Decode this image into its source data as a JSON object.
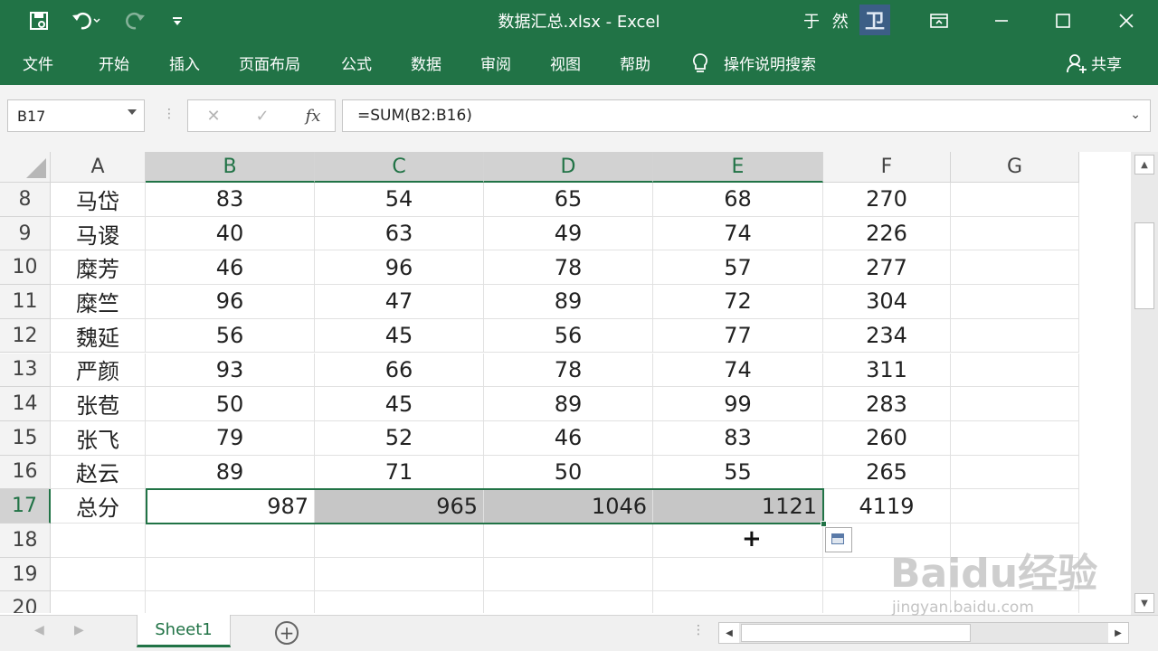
{
  "window": {
    "title": "数据汇总.xlsx  -  Excel",
    "user": "于 然",
    "user_avatar": "卫",
    "icons": {
      "save": "save-icon",
      "undo": "undo-icon",
      "redo": "redo-icon",
      "customize": "customize-qat-icon",
      "ribbon_display": "ribbon-display-icon",
      "minimize": "minimize-icon",
      "maximize": "maximize-icon",
      "close": "close-icon"
    }
  },
  "ribbon": {
    "tabs": [
      "文件",
      "开始",
      "插入",
      "页面布局",
      "公式",
      "数据",
      "审阅",
      "视图",
      "帮助"
    ],
    "tell_me": "操作说明搜索",
    "share": "共享"
  },
  "formula_bar": {
    "name_box": "B17",
    "cancel": "✕",
    "enter": "✓",
    "fx": "fx",
    "formula": "=SUM(B2:B16)"
  },
  "grid": {
    "columns": [
      "A",
      "B",
      "C",
      "D",
      "E",
      "F",
      "G"
    ],
    "rows": [
      {
        "num": "8",
        "cells": [
          "马岱",
          "83",
          "54",
          "65",
          "68",
          "270",
          ""
        ]
      },
      {
        "num": "9",
        "cells": [
          "马谡",
          "40",
          "63",
          "49",
          "74",
          "226",
          ""
        ]
      },
      {
        "num": "10",
        "cells": [
          "糜芳",
          "46",
          "96",
          "78",
          "57",
          "277",
          ""
        ]
      },
      {
        "num": "11",
        "cells": [
          "糜竺",
          "96",
          "47",
          "89",
          "72",
          "304",
          ""
        ]
      },
      {
        "num": "12",
        "cells": [
          "魏延",
          "56",
          "45",
          "56",
          "77",
          "234",
          ""
        ]
      },
      {
        "num": "13",
        "cells": [
          "严颜",
          "93",
          "66",
          "78",
          "74",
          "311",
          ""
        ]
      },
      {
        "num": "14",
        "cells": [
          "张苞",
          "50",
          "45",
          "89",
          "99",
          "283",
          ""
        ]
      },
      {
        "num": "15",
        "cells": [
          "张飞",
          "79",
          "52",
          "46",
          "83",
          "260",
          ""
        ]
      },
      {
        "num": "16",
        "cells": [
          "赵云",
          "89",
          "71",
          "50",
          "55",
          "265",
          ""
        ]
      },
      {
        "num": "17",
        "cells": [
          "总分",
          "987",
          "965",
          "1046",
          "1121",
          "4119",
          ""
        ]
      },
      {
        "num": "18",
        "cells": [
          "",
          "",
          "",
          "",
          "",
          "",
          ""
        ]
      },
      {
        "num": "19",
        "cells": [
          "",
          "",
          "",
          "",
          "",
          "",
          ""
        ]
      },
      {
        "num": "20",
        "cells": [
          "",
          "",
          "",
          "",
          "",
          "",
          ""
        ]
      }
    ],
    "selected_columns": [
      "B",
      "C",
      "D",
      "E"
    ],
    "selected_row": "17"
  },
  "sheets": {
    "tabs": [
      "Sheet1"
    ],
    "add": "+"
  },
  "watermark": {
    "brand": "Baidu经验",
    "url": "jingyan.baidu.com"
  }
}
